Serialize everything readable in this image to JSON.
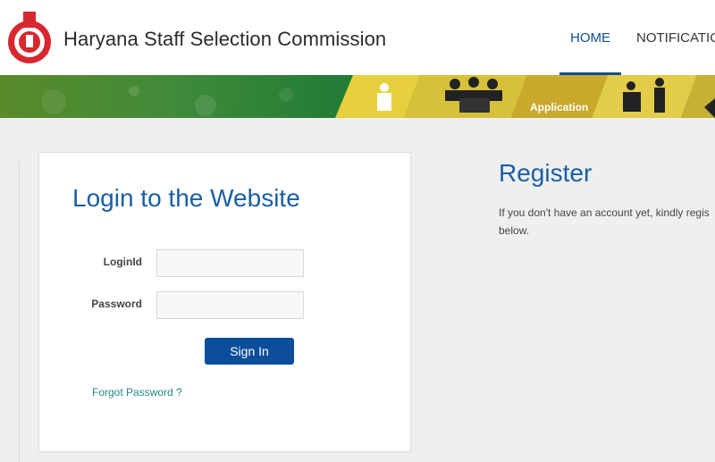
{
  "header": {
    "site_title": "Haryana Staff Selection Commission",
    "logo_icon": "emblem-icon",
    "nav": {
      "home": "HOME",
      "notification": "NOTIFICATIO"
    },
    "accent_color": "#0b4f8f"
  },
  "banner": {
    "application_label": "Application"
  },
  "login": {
    "title": "Login to the Website",
    "login_label": "LoginId",
    "password_label": "Password",
    "login_value": "",
    "password_value": "",
    "sign_in_label": "Sign In",
    "forgot_label": "Forgot Password ?"
  },
  "register": {
    "title": "Register",
    "text_line1": "If you don't have an account yet, kindly regis",
    "text_line2": "below."
  }
}
